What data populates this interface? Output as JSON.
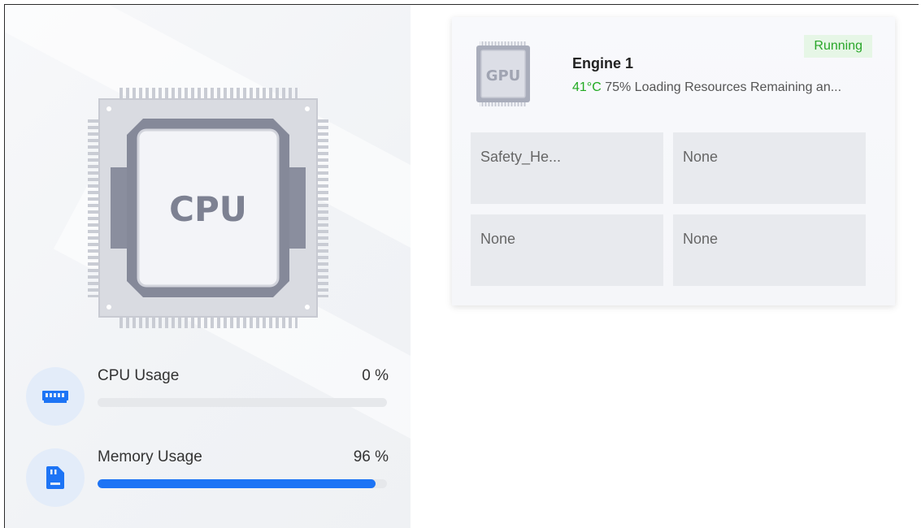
{
  "cpu_panel": {
    "chip_label": "CPU",
    "metrics": [
      {
        "label": "CPU Usage",
        "value": "0 %",
        "percent": 0,
        "icon": "memory-module-icon"
      },
      {
        "label": "Memory Usage",
        "value": "96 %",
        "percent": 96,
        "icon": "storage-card-icon"
      }
    ]
  },
  "engine": {
    "chip_label": "GPU",
    "title": "Engine 1",
    "temperature": "41°C",
    "load": "75% Loading Resources Remaining an...",
    "status": "Running",
    "slots": [
      "Safety_He...",
      "None",
      "None",
      "None"
    ]
  },
  "colors": {
    "accent": "#1d74f5",
    "running_green": "#29a629",
    "temp_green": "#22aa22"
  }
}
